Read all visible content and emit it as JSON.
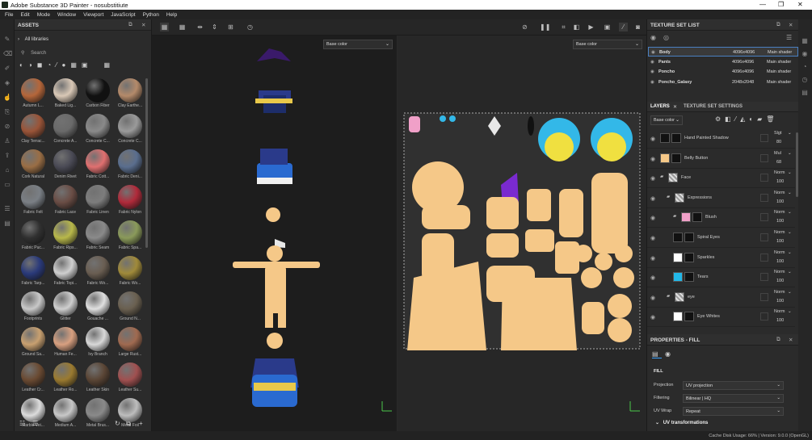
{
  "window": {
    "title": "Adobe Substance 3D Painter - nosubstitiute",
    "controls": [
      "—",
      "❐",
      "✕"
    ]
  },
  "menu": [
    "File",
    "Edit",
    "Mode",
    "Window",
    "Viewport",
    "JavaScript",
    "Python",
    "Help"
  ],
  "assets": {
    "title": "ASSETS",
    "library": "All libraries",
    "search_placeholder": "Search",
    "items": [
      {
        "label": "Autumn L...",
        "color": "#b5663a"
      },
      {
        "label": "Baked Lig...",
        "color": "#d9c8b6"
      },
      {
        "label": "Carbon Fiber",
        "color": "#111111"
      },
      {
        "label": "Clay Earthe...",
        "color": "#b48a6a"
      },
      {
        "label": "Clay Terrac...",
        "color": "#9a5438"
      },
      {
        "label": "Concrete A...",
        "color": "#6a6a6a"
      },
      {
        "label": "Concrete C...",
        "color": "#8a8a8a"
      },
      {
        "label": "Concrete C...",
        "color": "#9a9a9a"
      },
      {
        "label": "Cork Natural",
        "color": "#9a6e45"
      },
      {
        "label": "Denim Rivet",
        "color": "#4a4a55"
      },
      {
        "label": "Fabric Cott...",
        "color": "#e07070"
      },
      {
        "label": "Fabric Deni...",
        "color": "#5a6e8e"
      },
      {
        "label": "Fabric Felt",
        "color": "#7a7f85"
      },
      {
        "label": "Fabric Lace",
        "color": "#6a4d45"
      },
      {
        "label": "Fabric Linen",
        "color": "#7d7d7d"
      },
      {
        "label": "Fabric Nylon",
        "color": "#b02a3a"
      },
      {
        "label": "Fabric Puc...",
        "color": "#303030"
      },
      {
        "label": "Fabric Rips...",
        "color": "#b8b84a"
      },
      {
        "label": "Fabric Seam",
        "color": "#8a8a8a"
      },
      {
        "label": "Fabric Spa...",
        "color": "#8a9a5a"
      },
      {
        "label": "Fabric Tarp...",
        "color": "#2a3a7a"
      },
      {
        "label": "Fabric Topi...",
        "color": "#cfcfcf"
      },
      {
        "label": "Fabric Wo...",
        "color": "#6a5e52"
      },
      {
        "label": "Fabric Wo...",
        "color": "#a08a3a"
      },
      {
        "label": "Footprints",
        "color": "#c8c8c8"
      },
      {
        "label": "Glitter",
        "color": "#cfcfcf"
      },
      {
        "label": "Gouache ...",
        "color": "#e0e0e0"
      },
      {
        "label": "Ground N...",
        "color": "#6a6050"
      },
      {
        "label": "Ground Sa...",
        "color": "#c8a070"
      },
      {
        "label": "Human Fe...",
        "color": "#d8a080"
      },
      {
        "label": "Ivy Branch",
        "color": "#d8d8d8"
      },
      {
        "label": "Large Rust...",
        "color": "#a06a50"
      },
      {
        "label": "Leather Cr...",
        "color": "#6a4a32"
      },
      {
        "label": "Leather Ro...",
        "color": "#9a7a30"
      },
      {
        "label": "Leather Skin",
        "color": "#5a4535"
      },
      {
        "label": "Leather Su...",
        "color": "#a05050"
      },
      {
        "label": "Marble Vei...",
        "color": "#dcdcdc"
      },
      {
        "label": "Medium A...",
        "color": "#c8c8c8"
      },
      {
        "label": "Metal Brus...",
        "color": "#8a8a8a"
      },
      {
        "label": "Metal Foil",
        "color": "#bdbdbd"
      }
    ]
  },
  "viewport": {
    "left_channel": "Base color",
    "right_channel": "Base color"
  },
  "texture_set_list": {
    "title": "TEXTURE SET LIST",
    "rows": [
      {
        "name": "Body",
        "size": "4096x4096",
        "shader": "Main shader"
      },
      {
        "name": "Pants",
        "size": "4096x4096",
        "shader": "Main shader"
      },
      {
        "name": "Poncho",
        "size": "4096x4096",
        "shader": "Main shader"
      },
      {
        "name": "Poncho_Galaxy",
        "size": "2048x2048",
        "shader": "Main shader"
      }
    ]
  },
  "layers": {
    "tab_layers": "LAYERS",
    "tab_settings": "TEXTURE SET SETTINGS",
    "channel": "Base color",
    "rows": [
      {
        "name": "Hand Painted Shadow",
        "blend": "Slgt",
        "opacity": "80"
      },
      {
        "name": "Belly Button",
        "blend": "Mul",
        "opacity": "68"
      },
      {
        "name": "Face",
        "blend": "Norm",
        "opacity": "100"
      },
      {
        "name": "Expressions",
        "blend": "Norm",
        "opacity": "100"
      },
      {
        "name": "Blush",
        "blend": "Norm",
        "opacity": "100"
      },
      {
        "name": "Spiral Eyes",
        "blend": "Norm",
        "opacity": "100"
      },
      {
        "name": "Sparkles",
        "blend": "Norm",
        "opacity": "100"
      },
      {
        "name": "Tears",
        "blend": "Norm",
        "opacity": "100"
      },
      {
        "name": "eye",
        "blend": "Norm",
        "opacity": "100"
      },
      {
        "name": "Eye Whites",
        "blend": "Norm",
        "opacity": "100"
      }
    ]
  },
  "properties": {
    "title": "PROPERTIES - FILL",
    "section": "FILL",
    "projection_label": "Projection",
    "projection": "UV projection",
    "filtering_label": "Filtering",
    "filtering": "Bilinear | HQ",
    "uvwrap_label": "UV Wrap",
    "uvwrap": "Repeat",
    "uvtrans": "UV transformations"
  },
  "status": "Cache Disk Usage:  66% | Version: 9.0.0 (OpenGL)"
}
